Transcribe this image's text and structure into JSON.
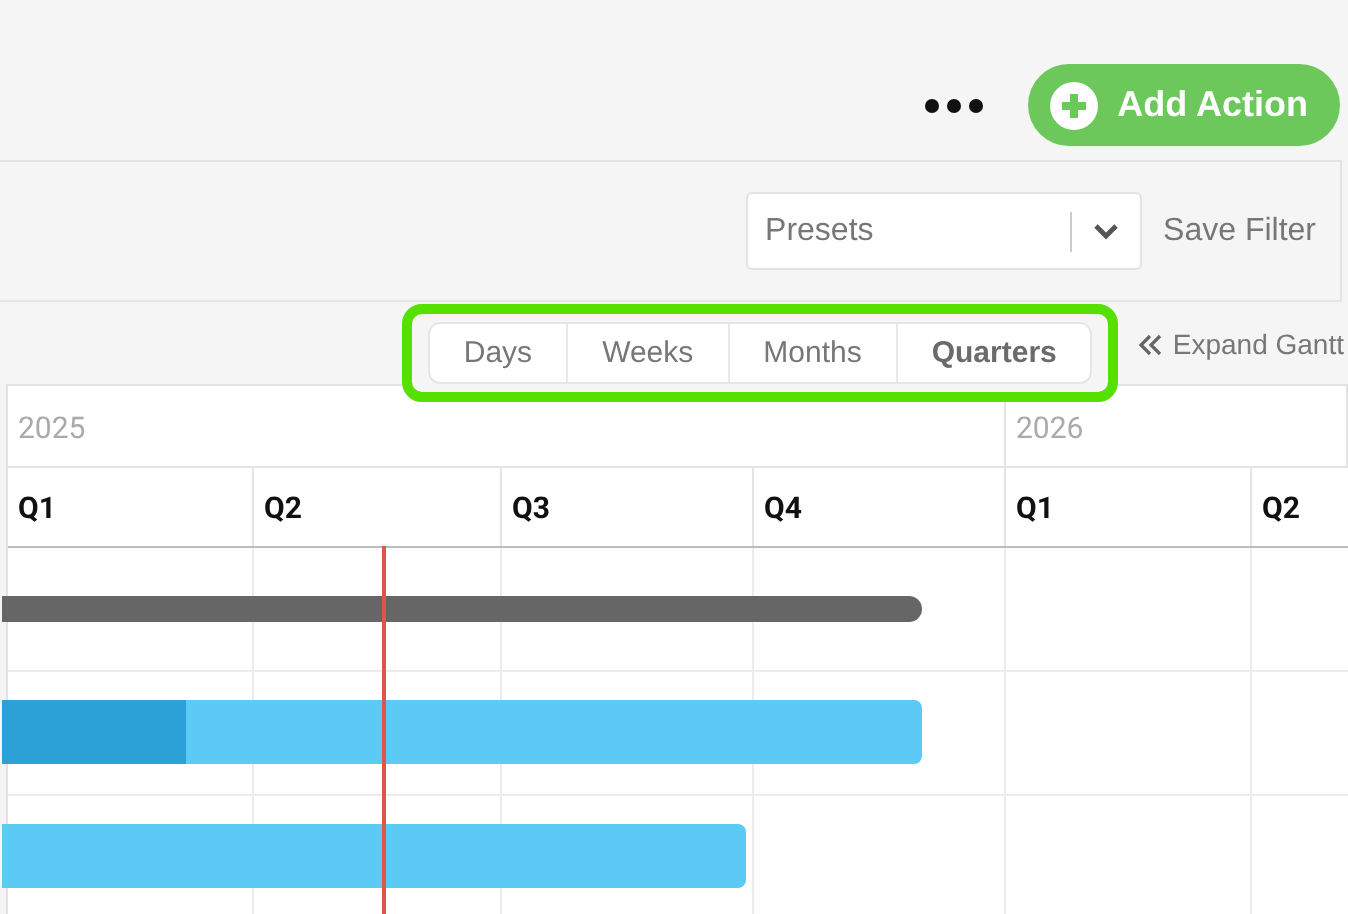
{
  "header": {
    "add_button": "Add Action"
  },
  "filter_bar": {
    "presets": {
      "placeholder": "Presets"
    },
    "save_button": "Save Filter"
  },
  "zoom": {
    "highlighted": true,
    "options": [
      {
        "label": "Days",
        "selected": false
      },
      {
        "label": "Weeks",
        "selected": false
      },
      {
        "label": "Months",
        "selected": false
      },
      {
        "label": "Quarters",
        "selected": true
      }
    ]
  },
  "expand_button": "Expand Gantt",
  "gantt": {
    "years": [
      "2025",
      "2026"
    ],
    "quarters": [
      "Q1",
      "Q2",
      "Q3",
      "Q4",
      "Q1",
      "Q2"
    ],
    "bars": [
      {
        "kind": "summary"
      },
      {
        "kind": "task",
        "level": 0.2
      },
      {
        "kind": "task"
      }
    ]
  }
}
